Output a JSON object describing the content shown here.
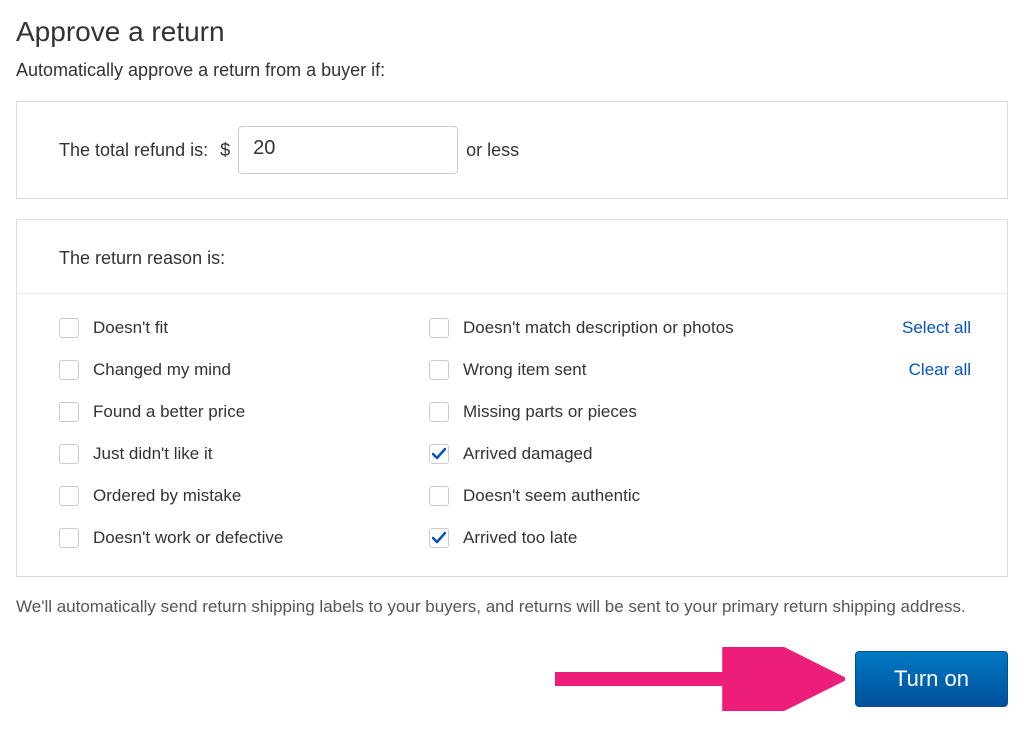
{
  "page": {
    "title": "Approve a return",
    "subtitle": "Automatically approve a return from a buyer if:"
  },
  "refund": {
    "label_before": "The total refund is:",
    "currency": "$",
    "value": "20",
    "label_after": "or less"
  },
  "reasons": {
    "header": "The return reason is:",
    "col1": [
      {
        "id": "doesnt-fit",
        "label": "Doesn't fit",
        "checked": false
      },
      {
        "id": "changed-mind",
        "label": "Changed my mind",
        "checked": false
      },
      {
        "id": "better-price",
        "label": "Found a better price",
        "checked": false
      },
      {
        "id": "didnt-like",
        "label": "Just didn't like it",
        "checked": false
      },
      {
        "id": "ordered-mistake",
        "label": "Ordered by mistake",
        "checked": false
      },
      {
        "id": "defective",
        "label": "Doesn't work or defective",
        "checked": false
      }
    ],
    "col2": [
      {
        "id": "no-match",
        "label": "Doesn't match description or photos",
        "checked": false
      },
      {
        "id": "wrong-item",
        "label": "Wrong item sent",
        "checked": false
      },
      {
        "id": "missing-parts",
        "label": "Missing parts or pieces",
        "checked": false
      },
      {
        "id": "arrived-damaged",
        "label": "Arrived damaged",
        "checked": true
      },
      {
        "id": "not-authentic",
        "label": "Doesn't seem authentic",
        "checked": false
      },
      {
        "id": "arrived-late",
        "label": "Arrived too late",
        "checked": true
      }
    ],
    "select_all": "Select all",
    "clear_all": "Clear all"
  },
  "footer_note": "We'll automatically send return shipping labels to your buyers, and returns will be sent to your primary return shipping address.",
  "action": {
    "turn_on": "Turn on"
  },
  "colors": {
    "link": "#0654ba",
    "button_bg_top": "#0079c1",
    "button_bg_bottom": "#00509d",
    "annotation_arrow": "#ec1e79"
  }
}
